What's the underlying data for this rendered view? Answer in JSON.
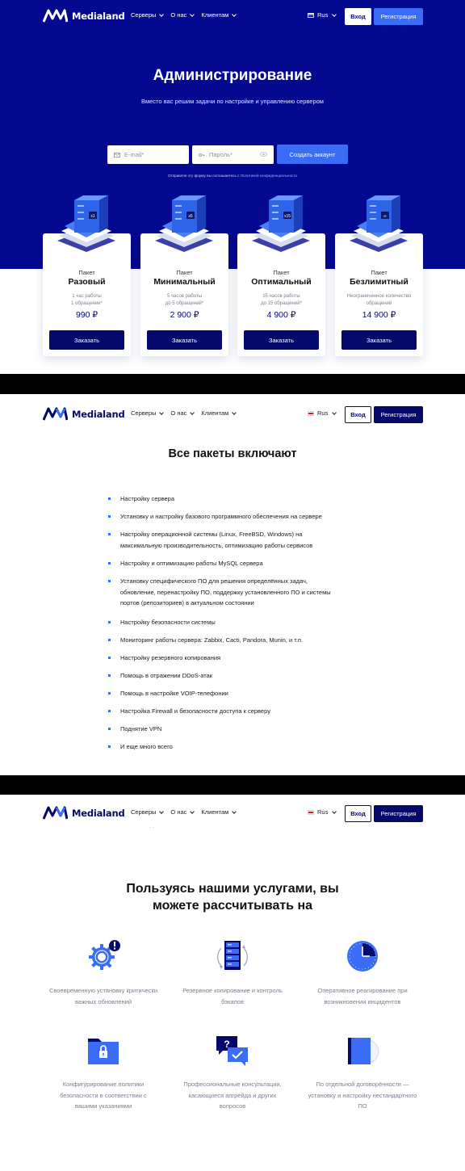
{
  "header": {
    "logo_text": "Medialand",
    "nav": [
      "Серверы",
      "О нас",
      "Клиентам"
    ],
    "lang": "Rus",
    "login": "Вход",
    "register": "Регистрация"
  },
  "hero": {
    "title": "Администрирование",
    "subtitle": "Вместо вас решим задачи по настройке и управлению сервером",
    "email_placeholder": "E-mail*",
    "password_placeholder": "Пароль*",
    "create_button": "Создать аккаунт",
    "agree_text": "Отправляя эту форму вы соглашаетесь с",
    "agree_link": "Политикой конфиденциальности"
  },
  "packages": [
    {
      "label": "Пакет",
      "name": "Разовый",
      "desc_1": "1 час работы",
      "desc_2": "1 обращение*",
      "price": "990 ₽",
      "badge": "x1",
      "button": "Заказать"
    },
    {
      "label": "Пакет",
      "name": "Минимальный",
      "desc_1": "5 часов работы",
      "desc_2": "до 5 обращений*",
      "price": "2 900 ₽",
      "badge": "x5",
      "button": "Заказать"
    },
    {
      "label": "Пакет",
      "name": "Оптимальный",
      "desc_1": "15 часов работы",
      "desc_2": "до 15 обращений*",
      "price": "4 900 ₽",
      "badge": "x15",
      "button": "Заказать"
    },
    {
      "label": "Пакет",
      "name": "Безлимитный",
      "desc_1": "Неограниченное количество",
      "desc_2": "обращений",
      "price": "14 900 ₽",
      "badge": "∞",
      "button": "Заказать"
    }
  ],
  "includes": {
    "title": "Все пакеты включают",
    "items": [
      {
        "l1": "Настройку сервера",
        "l2": "",
        "l3": ""
      },
      {
        "l1": "Установку и настройку базового программного обеспечения на сервере",
        "l2": "",
        "l3": ""
      },
      {
        "l1": "Настройку операционной системы (Linux, FreeBSD, Windows) на",
        "l2": "максимальную производительность, оптимизацию работы сервисов",
        "l3": ""
      },
      {
        "l1": "Настройку и оптимизацию работы MySQL сервера",
        "l2": "",
        "l3": ""
      },
      {
        "l1": "Установку специфического ПО для решения определённых задач,",
        "l2": "обновление, перенастройку ПО, поддержку установленного ПО и системы",
        "l3": "портов (репозиториев) в актуальном состоянии"
      },
      {
        "l1": "Настройку безопасности системы",
        "l2": "",
        "l3": ""
      },
      {
        "l1": "Мониторинг работы сервера: Zabbix, Cacti, Pandora, Munin, и т.п.",
        "l2": "",
        "l3": ""
      },
      {
        "l1": "Настройку резервного копирования",
        "l2": "",
        "l3": ""
      },
      {
        "l1": "Помощь в отражении DDoS-атак",
        "l2": "",
        "l3": ""
      },
      {
        "l1": "Помощь в настройке VOIP-телефонии",
        "l2": "",
        "l3": ""
      },
      {
        "l1": "Настройка Firewall и безопасности доступа к серверу",
        "l2": "",
        "l3": ""
      },
      {
        "l1": "Поднятие VPN",
        "l2": "",
        "l3": ""
      },
      {
        "l1": "И еще много всего",
        "l2": "",
        "l3": ""
      }
    ]
  },
  "benefits": {
    "dots": "· ·",
    "title_l1": "Пользуясь нашими услугами, вы",
    "title_l2": "можете рассчитывать на",
    "items": [
      {
        "icon": "gear-alert-icon",
        "l1": "Своевременную установку критически",
        "l2": "важных обновлений",
        "l3": ""
      },
      {
        "icon": "server-sync-icon",
        "l1": "Резервное копирование и контроль",
        "l2": "бэкапов",
        "l3": ""
      },
      {
        "icon": "clock-icon",
        "l1": "Оперативное реагирование при",
        "l2": "возникновении инцидентов",
        "l3": ""
      },
      {
        "icon": "locked-folder-icon",
        "l1": "Конфигурирование политики",
        "l2": "безопасности в соответствии с",
        "l3": "вашими указаниями"
      },
      {
        "icon": "chat-question-icon",
        "l1": "Профессиональные консультации,",
        "l2": "касающиеся апгрейда и других",
        "l3": "вопросов"
      },
      {
        "icon": "disc-box-icon",
        "l1": "По отдельной договорённости —",
        "l2": "установку и настройку нестандартного",
        "l3": "ПО"
      }
    ]
  },
  "colors": {
    "brand_dark": "#05098f",
    "brand_navy": "#05096b",
    "accent": "#3a6cf6"
  }
}
